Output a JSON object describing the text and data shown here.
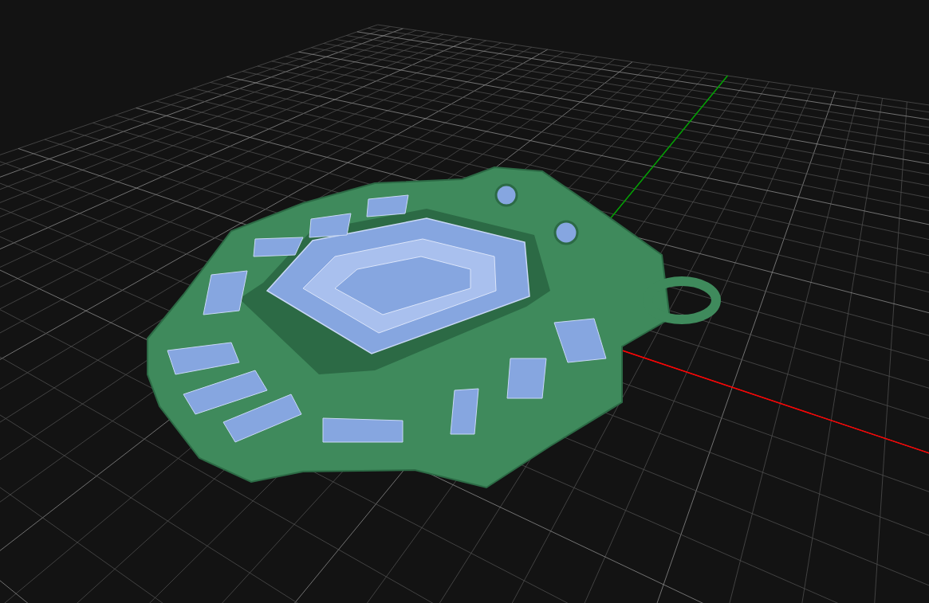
{
  "viewport": {
    "axes": [
      {
        "kind": "x",
        "color": "#ff0000"
      },
      {
        "kind": "y",
        "color": "#00a000"
      }
    ]
  }
}
